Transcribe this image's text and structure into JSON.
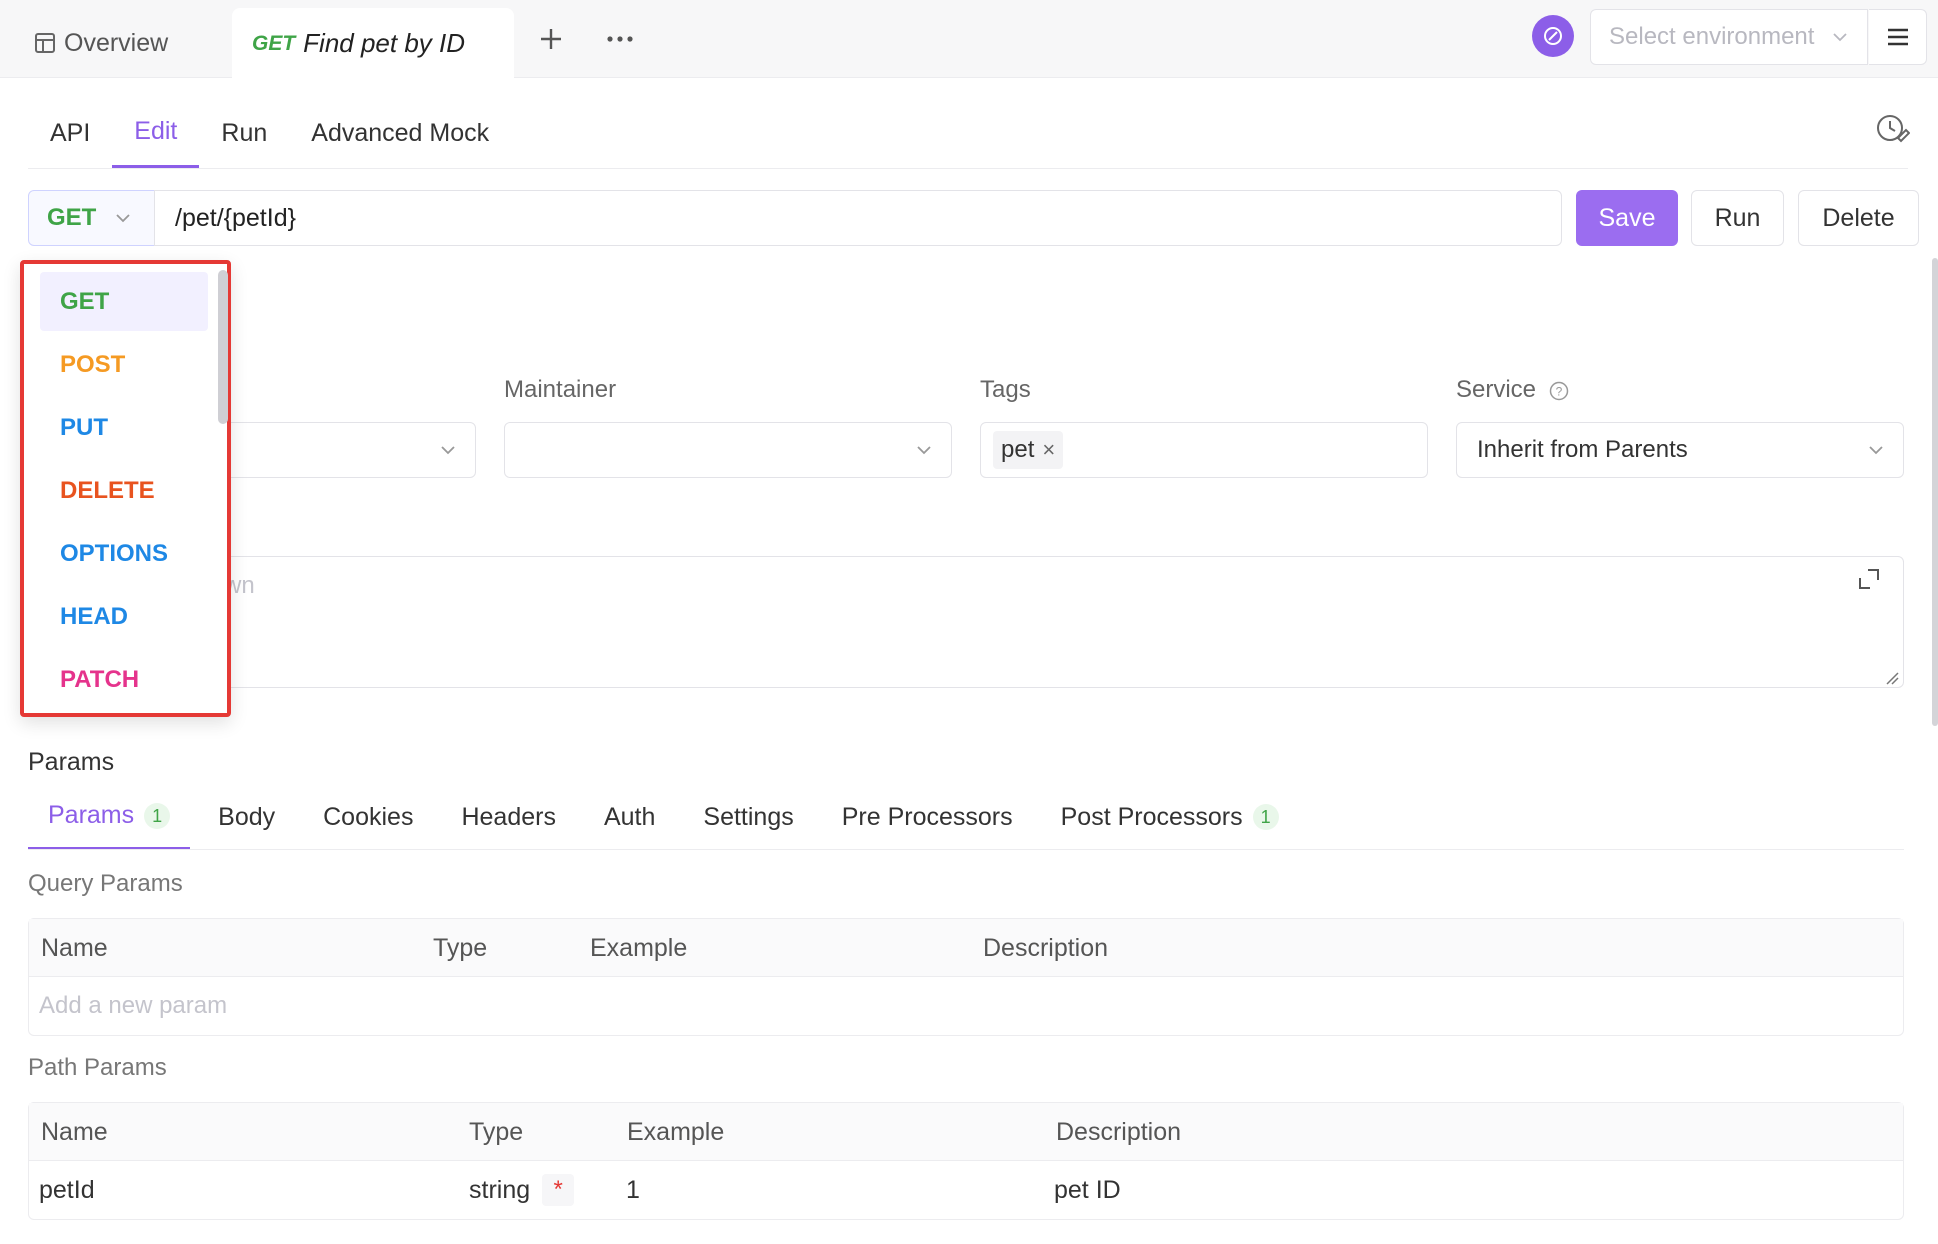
{
  "top_tabs": {
    "overview_label": "Overview",
    "active_method": "GET",
    "active_title": "Find pet by ID"
  },
  "environment": {
    "placeholder": "Select environment"
  },
  "sub_tabs": [
    {
      "label": "API",
      "active": false
    },
    {
      "label": "Edit",
      "active": true
    },
    {
      "label": "Run",
      "active": false
    },
    {
      "label": "Advanced Mock",
      "active": false
    }
  ],
  "request": {
    "method": "GET",
    "url": "/pet/{petId}",
    "save_label": "Save",
    "run_label": "Run",
    "delete_label": "Delete"
  },
  "fields": {
    "maintainer_label": "Maintainer",
    "tags_label": "Tags",
    "tag_value": "pet",
    "service_label": "Service",
    "service_value": "Inherit from Parents",
    "description_placeholder_fragment": "wn"
  },
  "method_dropdown": {
    "items": [
      {
        "label": "GET",
        "color": "#3fa447",
        "selected": true
      },
      {
        "label": "POST",
        "color": "#f59a23",
        "selected": false
      },
      {
        "label": "PUT",
        "color": "#1e88e5",
        "selected": false
      },
      {
        "label": "DELETE",
        "color": "#e8531f",
        "selected": false
      },
      {
        "label": "OPTIONS",
        "color": "#1e88e5",
        "selected": false
      },
      {
        "label": "HEAD",
        "color": "#1e88e5",
        "selected": false
      },
      {
        "label": "PATCH",
        "color": "#e5338c",
        "selected": false
      }
    ]
  },
  "params": {
    "section_title": "Params",
    "tabs": [
      {
        "label": "Params",
        "badge": "1",
        "active": true
      },
      {
        "label": "Body",
        "badge": "",
        "active": false
      },
      {
        "label": "Cookies",
        "badge": "",
        "active": false
      },
      {
        "label": "Headers",
        "badge": "",
        "active": false
      },
      {
        "label": "Auth",
        "badge": "",
        "active": false
      },
      {
        "label": "Settings",
        "badge": "",
        "active": false
      },
      {
        "label": "Pre Processors",
        "badge": "",
        "active": false
      },
      {
        "label": "Post Processors",
        "badge": "1",
        "active": false
      }
    ],
    "query_label": "Query Params",
    "query_columns": [
      "Name",
      "Type",
      "Example",
      "Description"
    ],
    "query_add_placeholder": "Add a new param",
    "path_label": "Path Params",
    "path_columns": [
      "Name",
      "Type",
      "Example",
      "Description"
    ],
    "path_rows": [
      {
        "name": "petId",
        "type": "string",
        "required_mark": "*",
        "example": "1",
        "description": "pet ID"
      }
    ]
  },
  "colors": {
    "accent": "#8c5ee8",
    "save_button": "#9b6df0",
    "get": "#3fa447",
    "highlight_border": "#e53935"
  }
}
